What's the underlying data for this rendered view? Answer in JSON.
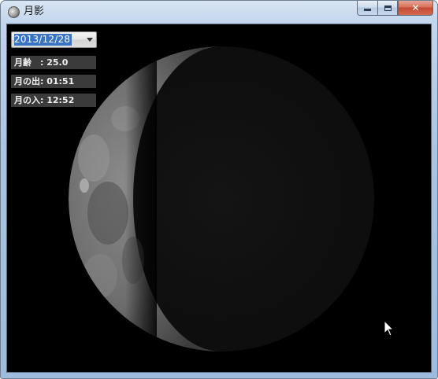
{
  "window": {
    "title": "月影",
    "icon": "moon-app-icon",
    "caption": {
      "minimize_icon": "minimize-icon",
      "maximize_icon": "maximize-icon",
      "close_glyph": "✕"
    }
  },
  "date_picker": {
    "value": "2013/12/28",
    "icon": "chevron-down-icon"
  },
  "info": {
    "moon_age": "月齢　: 25.0",
    "moonrise": "月の出: 01:51",
    "moonset": "月の入: 12:52"
  },
  "colors": {
    "client_bg": "#000000",
    "info_bg": "#3b3b3b",
    "selection": "#3a73c4",
    "close_button": "#c24a33"
  }
}
